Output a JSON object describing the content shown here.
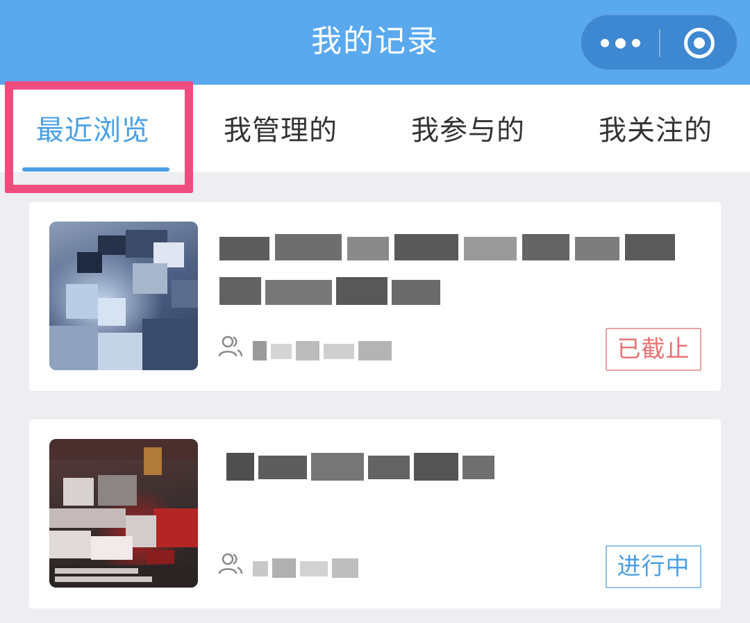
{
  "navbar": {
    "title": "我的记录",
    "more_icon": "more-dots-icon",
    "close_icon": "capsule-close-icon",
    "background": "#5aa9ee"
  },
  "tabs": [
    {
      "label": "最近浏览",
      "active": true
    },
    {
      "label": "我管理的",
      "active": false
    },
    {
      "label": "我参与的",
      "active": false
    },
    {
      "label": "我关注的",
      "active": false
    }
  ],
  "accent_color": "#4a9fe4",
  "annotation_color": "#ee4d7d",
  "activities": [
    {
      "status": "已截止",
      "status_color": "#e57474",
      "people_icon": "people-icon"
    },
    {
      "status": "进行中",
      "status_color": "#4a9fe4",
      "people_icon": "people-icon"
    }
  ]
}
